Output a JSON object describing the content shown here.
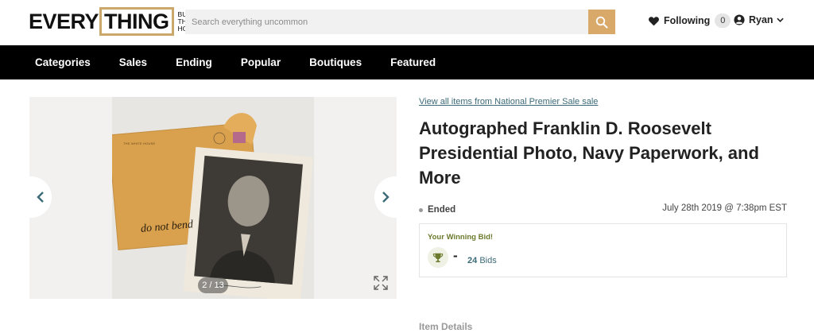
{
  "logo": {
    "every": "EVERY",
    "thing": "THING",
    "sub": [
      "BUT",
      "THE",
      "HOUSE"
    ]
  },
  "search": {
    "placeholder": "Search everything uncommon"
  },
  "header": {
    "following_label": "Following",
    "following_count": "0",
    "user_name": "Ryan"
  },
  "nav": {
    "items": [
      "Categories",
      "Sales",
      "Ending",
      "Popular",
      "Boutiques",
      "Featured"
    ]
  },
  "gallery": {
    "counter": "2 / 13",
    "envelope_text": "do not bend",
    "envelope_header": "THE WHITE HOUSE"
  },
  "item": {
    "view_all_link": "View all items from National Premier Sale sale",
    "title": "Autographed Franklin D. Roosevelt Presidential Photo, Navy Paperwork, and More",
    "status": "Ended",
    "end_date": "July 28th 2019 @ 7:38pm EST",
    "bid_label": "Your Winning Bid!",
    "bid_value": "-",
    "bid_count": "24",
    "bid_suffix": "Bids",
    "details_heading": "Item Details"
  },
  "colors": {
    "accent": "#d9a96a",
    "link": "#3b6a78",
    "nav_bg": "#000000",
    "winning_label": "#6b7a2c"
  }
}
